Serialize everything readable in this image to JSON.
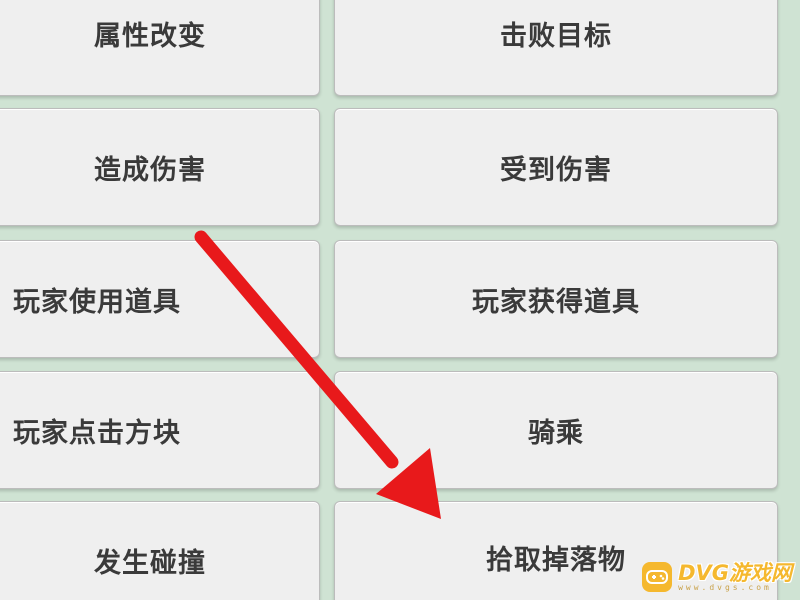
{
  "buttons": {
    "attribute_change": "属性改变",
    "defeat_target": "击败目标",
    "cause_damage": "造成伤害",
    "take_damage": "受到伤害",
    "player_use_item": "玩家使用道具",
    "player_get_item": "玩家获得道具",
    "player_click_block": "玩家点击方块",
    "ride": "骑乘",
    "collision_occurs": "发生碰撞",
    "pick_up_drop": "拾取掉落物"
  },
  "annotation": {
    "arrow_color": "#e8191b",
    "points_to": "拾取掉落物"
  },
  "watermark": {
    "text": "DVG游戏网",
    "subtext": "www.dvgs.com",
    "color": "#f5b82e"
  },
  "colors": {
    "background": "#cfe3d3",
    "button_face": "#efefef",
    "button_text": "#3a3a3a"
  }
}
